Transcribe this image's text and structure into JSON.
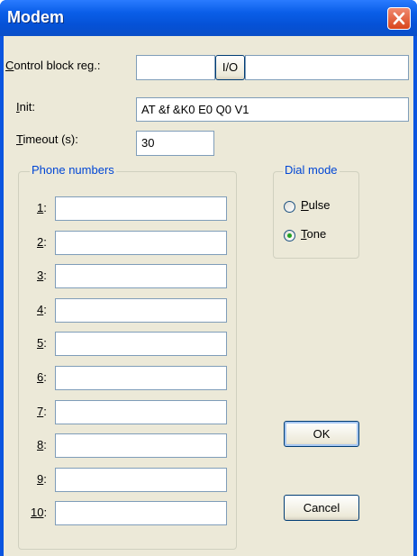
{
  "window": {
    "title": "Modem"
  },
  "control_block": {
    "label": "Control block reg.:",
    "value1": "",
    "io_button": "I/O",
    "value2": ""
  },
  "init": {
    "label": "Init:",
    "value": "AT &f &K0 E0 Q0 V1"
  },
  "timeout": {
    "label": "Timeout (s):",
    "value": "30"
  },
  "phone_numbers": {
    "title": "Phone numbers",
    "rows": [
      {
        "label": "1:",
        "value": ""
      },
      {
        "label": "2:",
        "value": ""
      },
      {
        "label": "3:",
        "value": ""
      },
      {
        "label": "4:",
        "value": ""
      },
      {
        "label": "5:",
        "value": ""
      },
      {
        "label": "6:",
        "value": ""
      },
      {
        "label": "7:",
        "value": ""
      },
      {
        "label": "8:",
        "value": ""
      },
      {
        "label": "9:",
        "value": ""
      },
      {
        "label": "10:",
        "value": ""
      }
    ]
  },
  "dial_mode": {
    "title": "Dial mode",
    "options": [
      {
        "label": "Pulse",
        "selected": false
      },
      {
        "label": "Tone",
        "selected": true
      }
    ]
  },
  "buttons": {
    "ok": "OK",
    "cancel": "Cancel"
  },
  "colors": {
    "title_bar": "#0a5ee8",
    "group_title": "#0046d5",
    "face": "#ece9d8",
    "close": "#d9441c"
  }
}
